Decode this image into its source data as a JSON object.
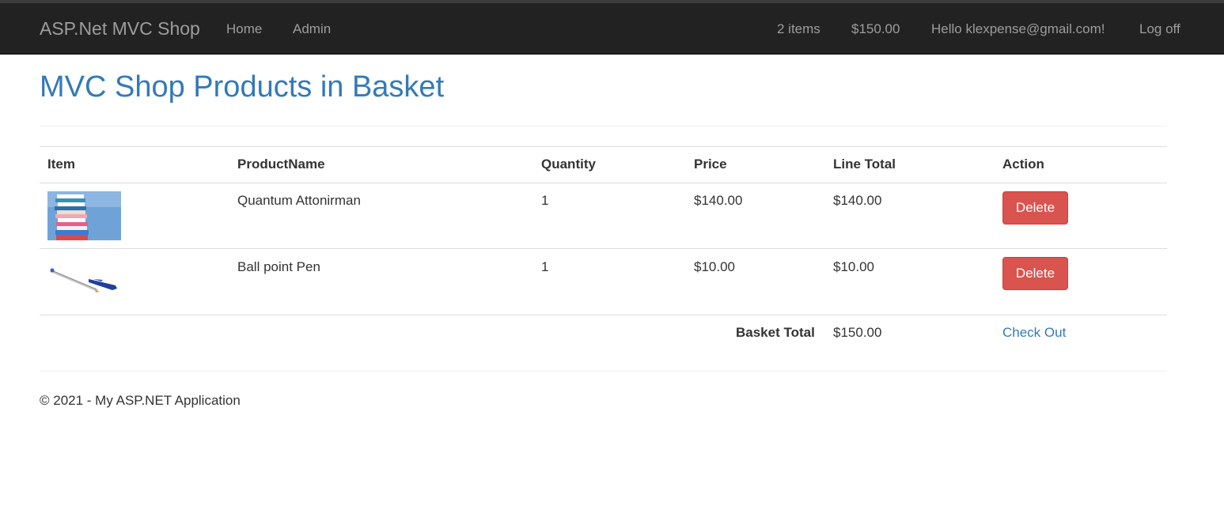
{
  "navbar": {
    "brand": "ASP.Net MVC Shop",
    "links": [
      "Home",
      "Admin"
    ],
    "basket_count": "2 items",
    "basket_total": "$150.00",
    "greeting": "Hello klexpense@gmail.com!",
    "logoff": "Log off"
  },
  "page": {
    "title": "MVC Shop Products in Basket"
  },
  "table": {
    "headers": [
      "Item",
      "ProductName",
      "Quantity",
      "Price",
      "Line Total",
      "Action"
    ],
    "rows": [
      {
        "image": "books-stack-image",
        "product": "Quantum Attonirman",
        "quantity": "1",
        "price": "$140.00",
        "line_total": "$140.00",
        "action": "Delete"
      },
      {
        "image": "ballpoint-pen-image",
        "product": "Ball point Pen",
        "quantity": "1",
        "price": "$10.00",
        "line_total": "$10.00",
        "action": "Delete"
      }
    ],
    "total_label": "Basket Total",
    "total_value": "$150.00",
    "checkout": "Check Out"
  },
  "footer": {
    "text": "© 2021 - My ASP.NET Application"
  },
  "colors": {
    "navbar_bg": "#222222",
    "nav_text": "#9d9d9d",
    "link": "#337ab7",
    "danger": "#d9534f"
  }
}
